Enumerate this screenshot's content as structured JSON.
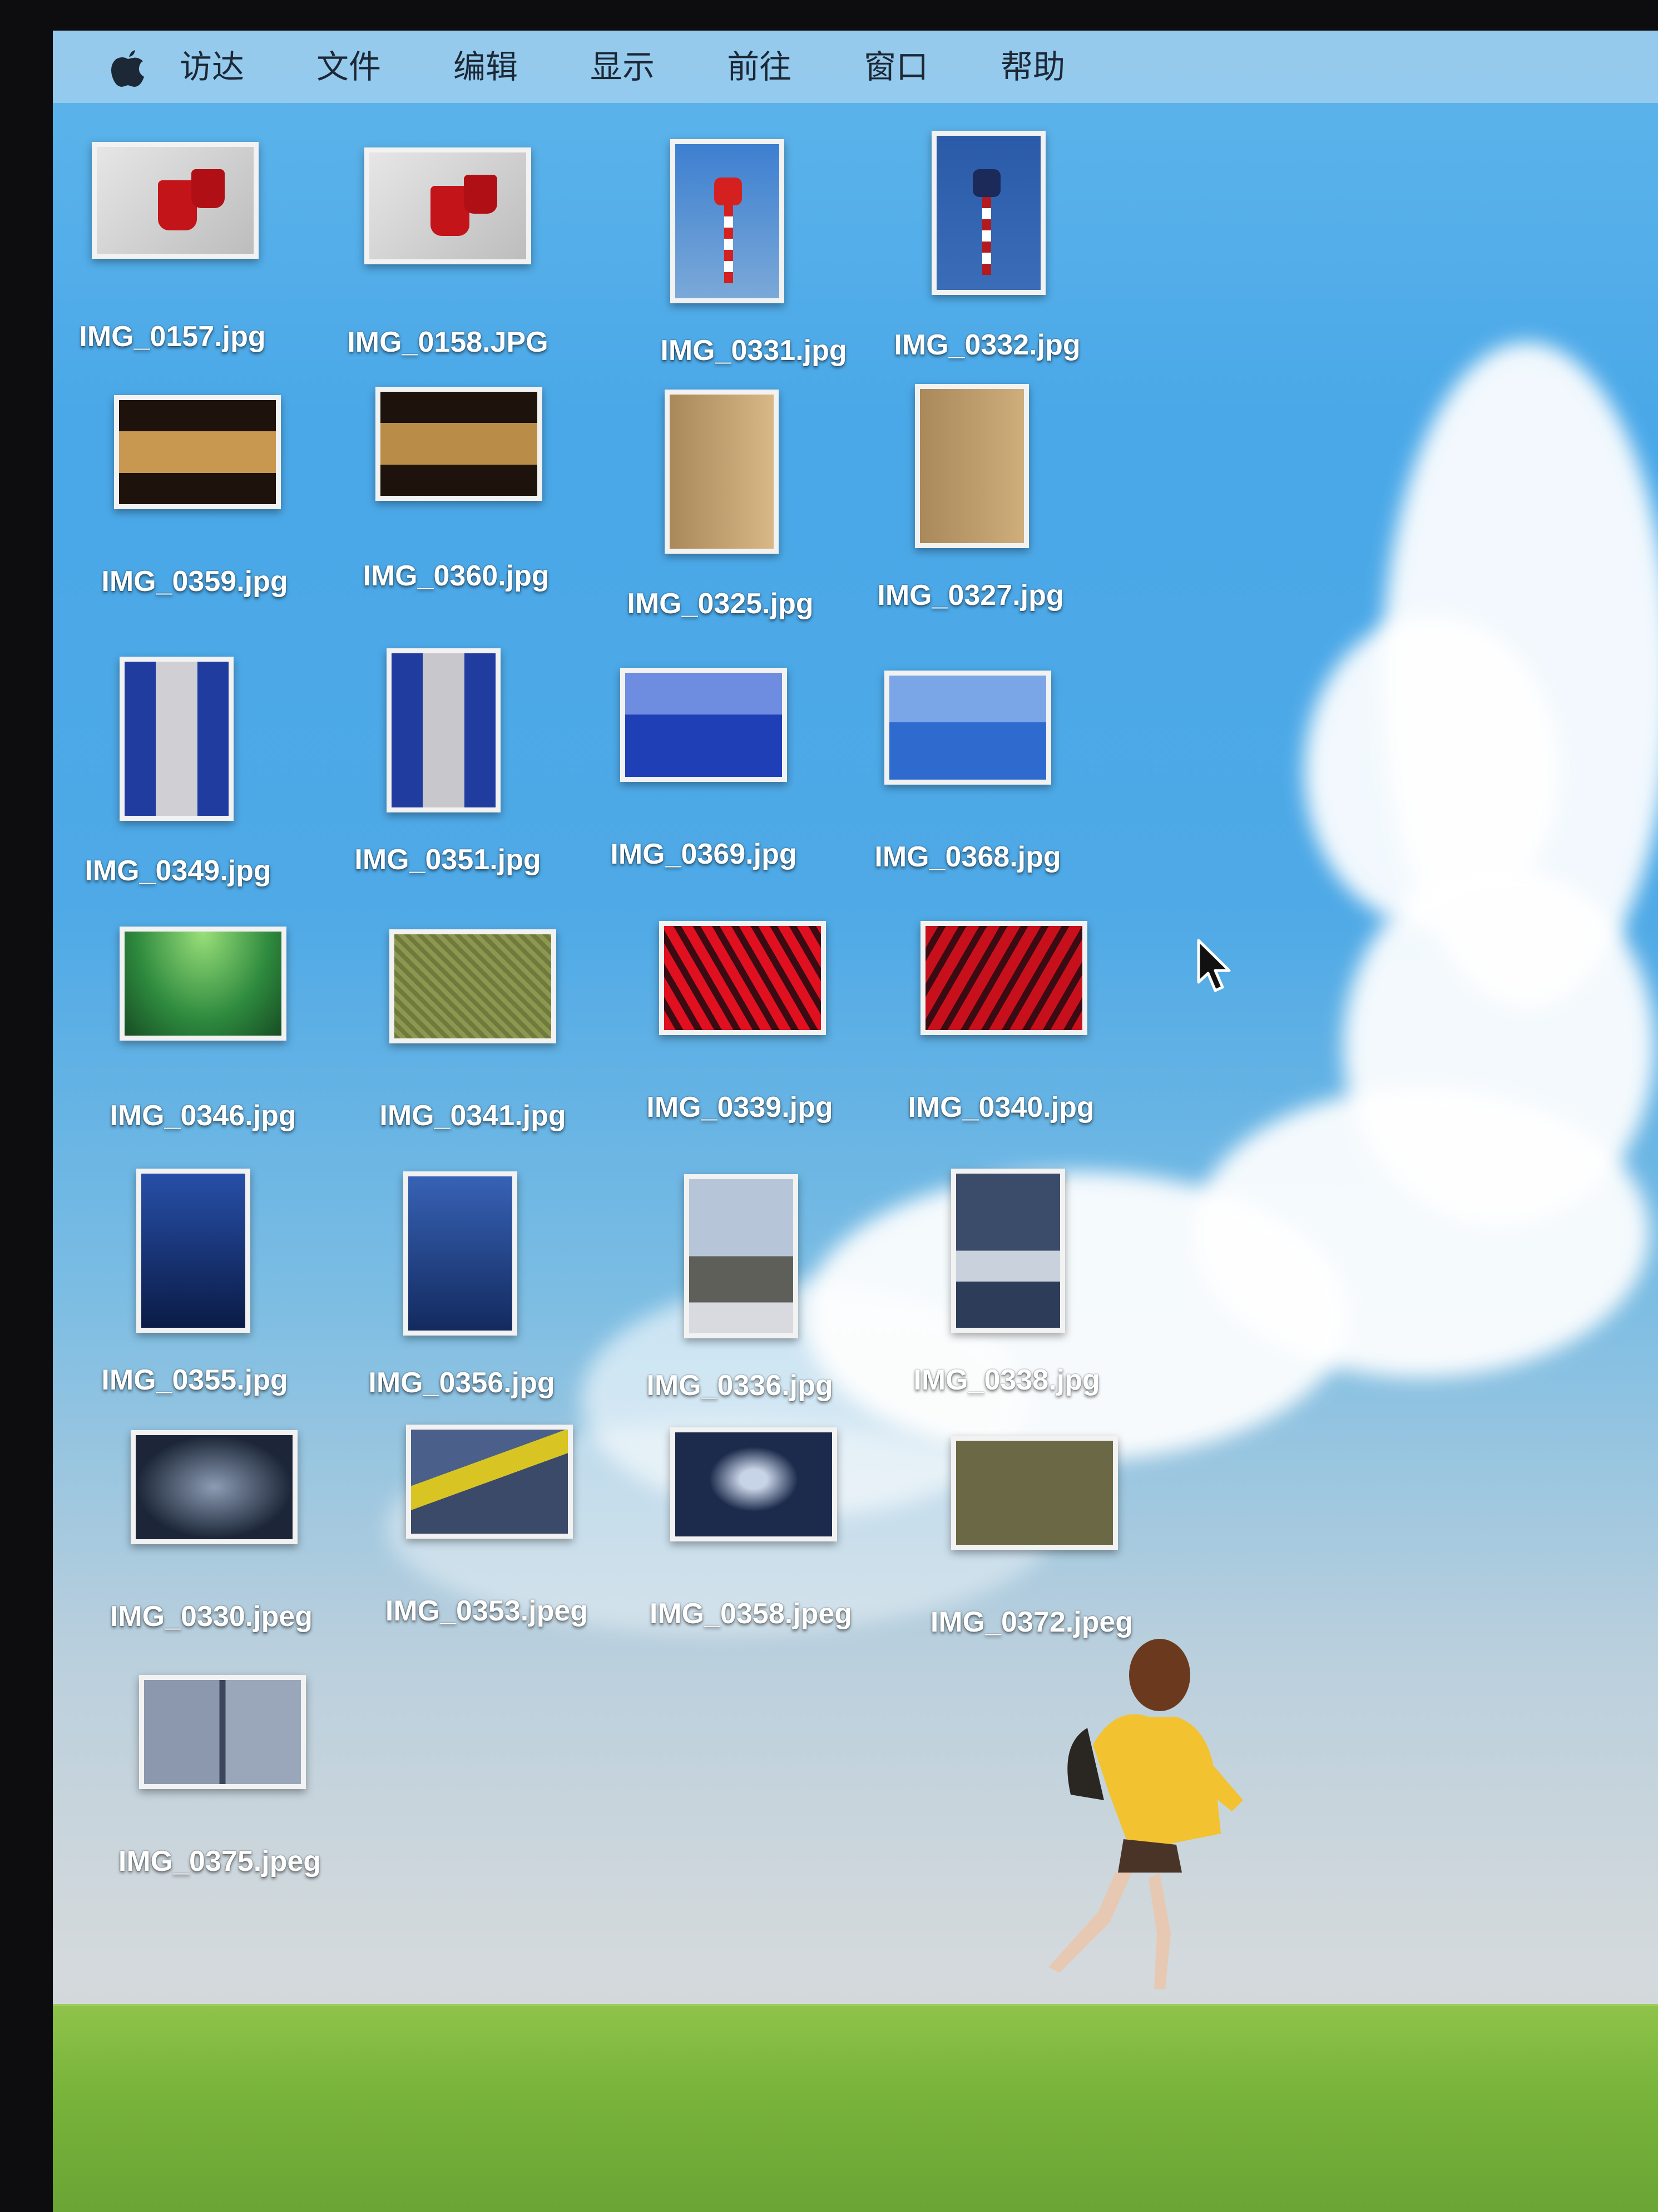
{
  "menubar": {
    "apple_icon": "apple-logo-icon",
    "items": [
      "访达",
      "文件",
      "编辑",
      "显示",
      "前往",
      "窗口",
      "帮助"
    ]
  },
  "desktop": {
    "files": [
      {
        "name": "IMG_0157.jpg",
        "thumb": "red-mugs"
      },
      {
        "name": "IMG_0158.JPG",
        "thumb": "red-mugs"
      },
      {
        "name": "IMG_0331.jpg",
        "thumb": "stop-sign"
      },
      {
        "name": "IMG_0332.jpg",
        "thumb": "stop-sign-dark"
      },
      {
        "name": "IMG_0359.jpg",
        "thumb": "lobby-doors"
      },
      {
        "name": "IMG_0360.jpg",
        "thumb": "lobby-doors"
      },
      {
        "name": "IMG_0325.jpg",
        "thumb": "gallery-hall"
      },
      {
        "name": "IMG_0327.jpg",
        "thumb": "gallery-hall"
      },
      {
        "name": "IMG_0349.jpg",
        "thumb": "store-aisle"
      },
      {
        "name": "IMG_0351.jpg",
        "thumb": "store-aisle"
      },
      {
        "name": "IMG_0369.jpg",
        "thumb": "blue-skyline"
      },
      {
        "name": "IMG_0368.jpg",
        "thumb": "blue-skyline"
      },
      {
        "name": "IMG_0346.jpg",
        "thumb": "green-ceiling"
      },
      {
        "name": "IMG_0341.jpg",
        "thumb": "green-mesh"
      },
      {
        "name": "IMG_0339.jpg",
        "thumb": "red-sculpture"
      },
      {
        "name": "IMG_0340.jpg",
        "thumb": "red-sculpture"
      },
      {
        "name": "IMG_0355.jpg",
        "thumb": "blue-corridor"
      },
      {
        "name": "IMG_0356.jpg",
        "thumb": "blue-corridor"
      },
      {
        "name": "IMG_0336.jpg",
        "thumb": "city-tower"
      },
      {
        "name": "IMG_0338.jpg",
        "thumb": "city-street"
      },
      {
        "name": "IMG_0330.jpeg",
        "thumb": "crumpled-bag"
      },
      {
        "name": "IMG_0353.jpeg",
        "thumb": "caution-tape"
      },
      {
        "name": "IMG_0358.jpeg",
        "thumb": "plastic-bag"
      },
      {
        "name": "IMG_0372.jpeg",
        "thumb": "olive-texture"
      },
      {
        "name": "IMG_0375.jpeg",
        "thumb": "machines"
      }
    ]
  },
  "cursor_icon": "mouse-pointer-icon",
  "wallpaper": "sky-clouds-grass-running-child"
}
